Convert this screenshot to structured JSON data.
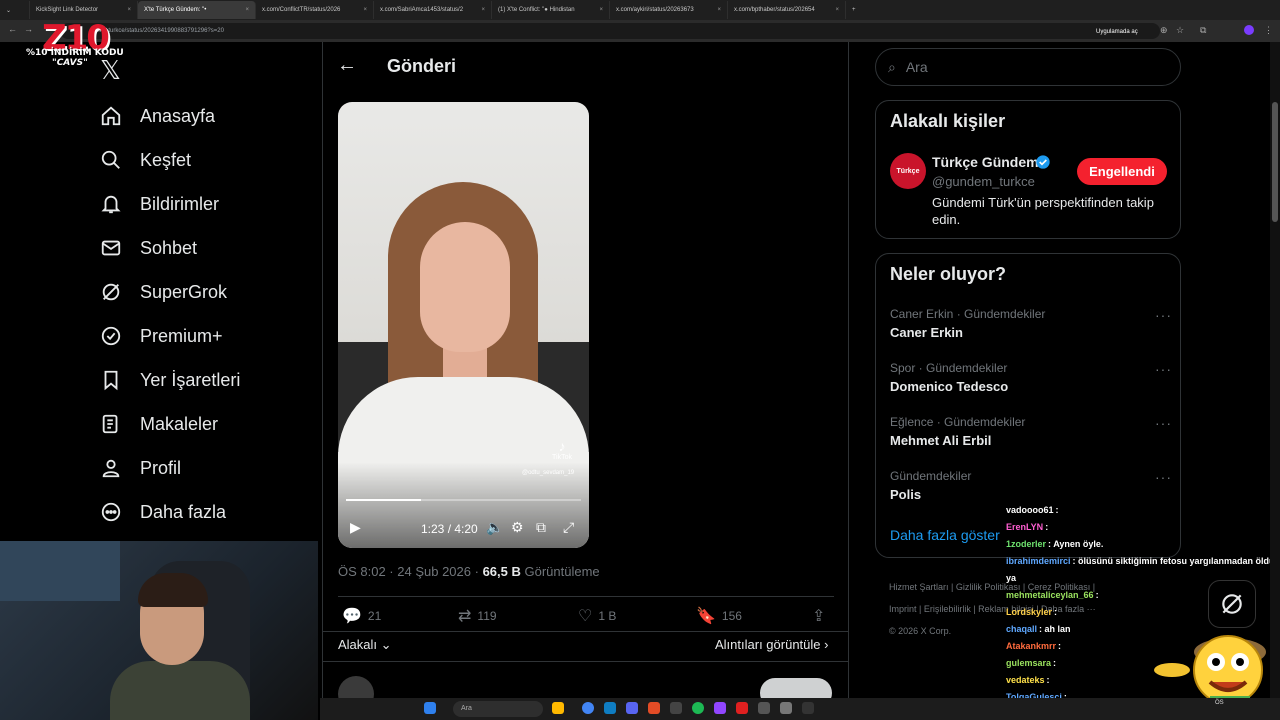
{
  "browser": {
    "tabs": [
      {
        "title": "KickSight Link Detector"
      },
      {
        "title": "X'te Türkçe Gündem: \"•",
        "active": true
      },
      {
        "title": "x.com/ConflictTR/status/2026"
      },
      {
        "title": "x.com/SabriAmca1453/status/2"
      },
      {
        "title": "(1) X'te Conflict: \"● Hindistan"
      },
      {
        "title": "x.com/aykiri/status/20263673"
      },
      {
        "title": "x.com/bpthaber/status/202654"
      }
    ],
    "url": "ndem_turkce/status/2026341990883791296?s=20",
    "app_badge": "Uygulamada aç"
  },
  "promo": {
    "logo": "Z10",
    "line1": "%10 İNDİRİM KODU",
    "line2": "\"CAVS\""
  },
  "sidebar": {
    "items": [
      {
        "label": "Anasayfa",
        "icon": "home-icon"
      },
      {
        "label": "Keşfet",
        "icon": "search-icon"
      },
      {
        "label": "Bildirimler",
        "icon": "bell-icon"
      },
      {
        "label": "Sohbet",
        "icon": "mail-icon"
      },
      {
        "label": "SuperGrok",
        "icon": "grok-icon"
      },
      {
        "label": "Premium+",
        "icon": "verified-badge-icon"
      },
      {
        "label": "Yer İşaretleri",
        "icon": "bookmark-icon"
      },
      {
        "label": "Makaleler",
        "icon": "article-icon"
      },
      {
        "label": "Profil",
        "icon": "person-icon"
      },
      {
        "label": "Daha fazla",
        "icon": "more-circle-icon"
      }
    ]
  },
  "post": {
    "header_title": "Gönderi",
    "video": {
      "time": "1:23 / 4:20",
      "progress": 0.32,
      "watermark": "TikTok",
      "watermark_user": "@odtu_sevdam_19"
    },
    "meta": {
      "time": "ÖS 8:02 · 24 Şub 2026 ·",
      "views": "66,5 B",
      "views_label": "Görüntüleme"
    },
    "stats": {
      "replies": "21",
      "reposts": "119",
      "likes": "1 B",
      "bookmarks": "156"
    },
    "relevance_label": "Alakalı",
    "quotes_label": "Alıntıları görüntüle"
  },
  "right": {
    "search_placeholder": "Ara",
    "people_title": "Alakalı kişiler",
    "person": {
      "avatar_text": "Türkçe",
      "name": "Türkçe Gündem",
      "handle": "@gundem_turkce",
      "button": "Engellendi",
      "bio": "Gündemi Türk'ün perspektifinden takip edin."
    },
    "trends_title": "Neler oluyor?",
    "trends": [
      {
        "context": "Caner Erkin · Gündemdekiler",
        "name": "Caner Erkin"
      },
      {
        "context": "Spor · Gündemdekiler",
        "name": "Domenico Tedesco"
      },
      {
        "context": "Eğlence · Gündemdekiler",
        "name": "Mehmet Ali Erbil"
      },
      {
        "context": "Gündemdekiler",
        "name": "Polis"
      }
    ],
    "show_more": "Daha fazla göster",
    "footer": {
      "line1": "Hizmet Şartları  |  Gizlilik Politikası  |  Çerez Politikası  |",
      "line2": "Imprint  |  Erişilebilirlik  |  Reklam bilgisi  |  Daha fazla ···",
      "line3": "© 2026 X Corp."
    }
  },
  "chat": [
    {
      "user": "vadoooo61",
      "msg": ":",
      "color": "#ffffff"
    },
    {
      "user": "ErenLYN",
      "msg": ":",
      "color": "#ff5fd2"
    },
    {
      "user": "1zoderler",
      "msg": ": Aynen öyle.",
      "color": "#6fe36f"
    },
    {
      "user": "ibrahimdemirci",
      "msg": ": ölüsünü siktiğimin fetosu yargılanmadan öldü ya",
      "color": "#5fa8ff"
    },
    {
      "user": "mehmetaliceylan_66",
      "msg": ":",
      "color": "#9be35f"
    },
    {
      "user": "Lordskyler",
      "msg": ":",
      "color": "#ffd14a"
    },
    {
      "user": "chaqall",
      "msg": ": ah lan",
      "color": "#5fa8ff"
    },
    {
      "user": "Atakankmrr",
      "msg": ":",
      "color": "#ff6b3d"
    },
    {
      "user": "gulemsara",
      "msg": ":",
      "color": "#9be35f"
    },
    {
      "user": "vedateks",
      "msg": ":",
      "color": "#ffe14a"
    },
    {
      "user": "TolgaGulesci",
      "msg": ":",
      "color": "#5fa8ff"
    },
    {
      "user": "ErenLYN",
      "msg": ":",
      "color": "#ff5fd2"
    }
  ],
  "taskbar": {
    "search": "Ara",
    "clock": "ÖS"
  }
}
